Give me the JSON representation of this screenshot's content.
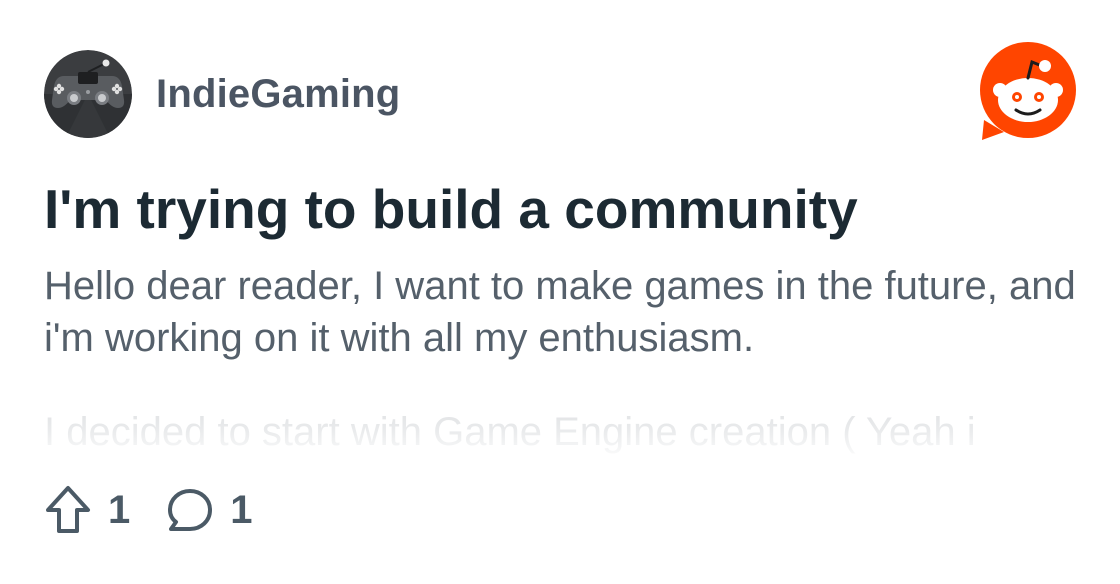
{
  "community": {
    "name": "IndieGaming",
    "avatar_icon": "gamepad-icon"
  },
  "brand": {
    "logo_icon": "reddit-snoo-icon",
    "accent_color": "#ff4500"
  },
  "post": {
    "title": "I'm trying to build a community",
    "body": "Hello dear reader, I want to make games in the future, and i'm working on it with all my enthusiasm.",
    "body_continued": "I decided to start with Game Engine creation ( Yeah i"
  },
  "actions": {
    "upvote_icon": "upvote-arrow-icon",
    "upvote_count": "1",
    "comment_icon": "comment-bubble-icon",
    "comment_count": "1"
  },
  "colors": {
    "title": "#1c2a33",
    "body": "#55606b",
    "muted": "#4b5a66"
  }
}
